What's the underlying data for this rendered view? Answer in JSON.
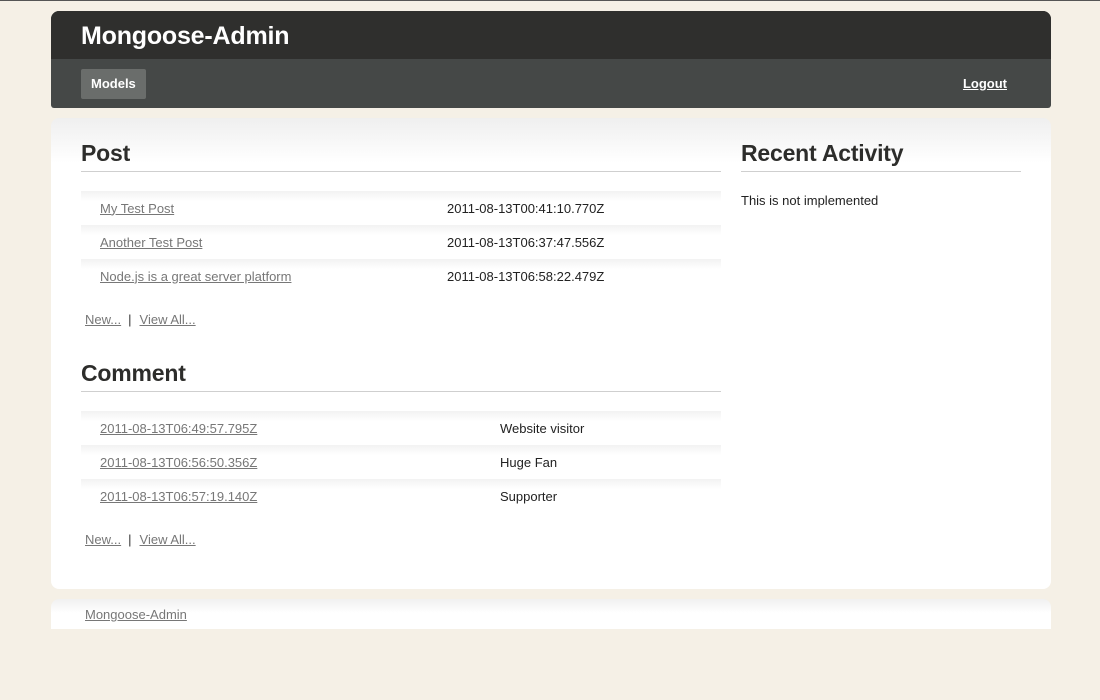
{
  "header": {
    "title": "Mongoose-Admin",
    "nav_models": "Models",
    "nav_logout": "Logout"
  },
  "post": {
    "title": "Post",
    "rows": [
      {
        "name": "My Test Post",
        "date": "2011-08-13T00:41:10.770Z"
      },
      {
        "name": "Another Test Post",
        "date": "2011-08-13T06:37:47.556Z"
      },
      {
        "name": "Node.js is a great server platform",
        "date": "2011-08-13T06:58:22.479Z"
      }
    ],
    "new_label": "New...",
    "separator": "|",
    "view_all_label": "View All..."
  },
  "comment": {
    "title": "Comment",
    "rows": [
      {
        "date": "2011-08-13T06:49:57.795Z",
        "author": "Website visitor"
      },
      {
        "date": "2011-08-13T06:56:50.356Z",
        "author": "Huge Fan"
      },
      {
        "date": "2011-08-13T06:57:19.140Z",
        "author": "Supporter"
      }
    ],
    "new_label": "New...",
    "separator": "|",
    "view_all_label": "View All..."
  },
  "recent_activity": {
    "title": "Recent Activity",
    "text": "This is not implemented"
  },
  "footer": {
    "link": "Mongoose-Admin"
  },
  "colors": {
    "background": "#f5f0e6",
    "header_dark": "#2f2f2d",
    "header_nav": "#454847",
    "nav_active": "#6a6d6b",
    "link": "#777777"
  }
}
